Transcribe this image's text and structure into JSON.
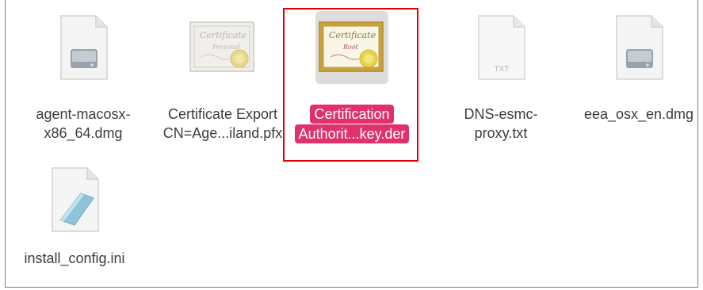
{
  "files": [
    {
      "id": "agent",
      "icon": "dmg-disk-image-icon",
      "lines": [
        "agent-macosx-",
        "x86_64.dmg"
      ],
      "selected": false
    },
    {
      "id": "cert-export",
      "icon": "certificate-personal-icon",
      "icon_text": [
        "Certificate",
        "Personal"
      ],
      "lines": [
        "Certificate Export",
        "CN=Age...iland.pfx"
      ],
      "selected": false
    },
    {
      "id": "ca-key",
      "icon": "certificate-root-icon",
      "icon_text": [
        "Certificate",
        "Root"
      ],
      "lines": [
        "Certification",
        "Authorit...key.der"
      ],
      "selected": true
    },
    {
      "id": "dns-proxy",
      "icon": "text-document-icon",
      "icon_text": [
        "TXT"
      ],
      "lines": [
        "DNS-esmc-",
        "proxy.txt"
      ],
      "selected": false
    },
    {
      "id": "eea",
      "icon": "dmg-disk-image-icon",
      "lines": [
        "eea_osx_en.dmg"
      ],
      "selected": false
    },
    {
      "id": "install-config",
      "icon": "ini-config-file-icon",
      "lines": [
        "install_config.ini"
      ],
      "selected": false
    }
  ],
  "colors": {
    "selection_label_bg": "#e0316e",
    "selection_label_text": "#ffffff",
    "highlight_box": "#e10000",
    "label_text": "#3c3c3c"
  }
}
